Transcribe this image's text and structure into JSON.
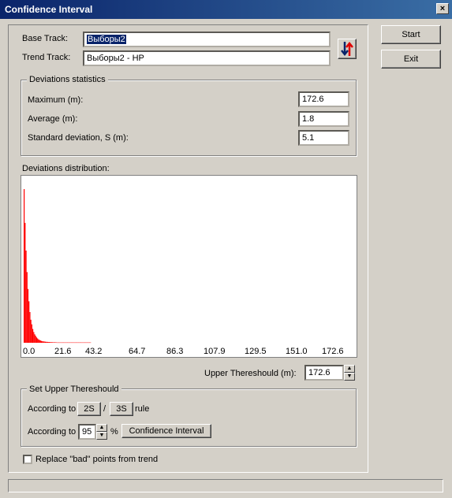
{
  "window": {
    "title": "Confidence Interval",
    "close_glyph": "×"
  },
  "form": {
    "base_track_label": "Base Track:",
    "base_track_value": "Выборы2",
    "trend_track_label": "Trend Track:",
    "trend_track_value": "Выборы2 - HP",
    "swap_icon": "swap-arrows-icon"
  },
  "buttons": {
    "start": "Start",
    "exit": "Exit"
  },
  "stats": {
    "title": "Deviations statistics",
    "maximum_label": "Maximum (m):",
    "maximum_value": "172.6",
    "average_label": "Average (m):",
    "average_value": "1.8",
    "stddev_label": "Standard deviation, S (m):",
    "stddev_value": "5.1"
  },
  "distribution": {
    "title": "Deviations distribution:",
    "ticks": [
      "0.0",
      "21.6",
      "43.2",
      "64.7",
      "86.3",
      "107.9",
      "129.5",
      "151.0",
      "172.6"
    ]
  },
  "chart_data": {
    "type": "bar",
    "title": "Deviations distribution:",
    "xlim": [
      0,
      172.6
    ],
    "x_ticks": [
      "0.0",
      "21.6",
      "43.2",
      "64.7",
      "86.3",
      "107.9",
      "129.5",
      "151.0",
      "172.6"
    ],
    "color": "#ff0000",
    "bin_width": 0.5,
    "values": [
      1.0,
      0.78,
      0.6,
      0.46,
      0.35,
      0.27,
      0.2,
      0.15,
      0.12,
      0.09,
      0.07,
      0.055,
      0.045,
      0.035,
      0.028,
      0.022,
      0.018,
      0.015,
      0.012,
      0.01,
      0.009,
      0.008,
      0.007,
      0.006,
      0.006,
      0.005,
      0.005,
      0.004,
      0.004,
      0.004,
      0.003,
      0.003,
      0.003,
      0.003,
      0.002,
      0.002,
      0.002,
      0.002,
      0.002,
      0.002,
      0.002,
      0.002,
      0.002,
      0.002,
      0.002,
      0.002,
      0.002,
      0.002,
      0.002,
      0.002,
      0.002,
      0.002,
      0.002,
      0.002,
      0.002,
      0.002,
      0.002,
      0.002,
      0.002,
      0.002,
      0.002,
      0.002,
      0.002,
      0.002,
      0.002,
      0.002,
      0.002,
      0.002,
      0.002,
      0.002
    ]
  },
  "upper": {
    "label": "Upper Thereshould (m):",
    "value": "172.6"
  },
  "set_upper": {
    "title": "Set Upper Thereshould",
    "according_to": "According to",
    "btn_2s": "2S",
    "slash": "/",
    "btn_3s": "3S",
    "rule": "rule",
    "according_to_2": "According to",
    "percent_value": "95",
    "percent_sign": "%",
    "ci_button": "Confidence Interval"
  },
  "replace_label": "Replace \"bad\" points from trend",
  "colors": {
    "titlebar": "#0a246a",
    "bars": "#ff0000",
    "face": "#d4d0c8"
  }
}
